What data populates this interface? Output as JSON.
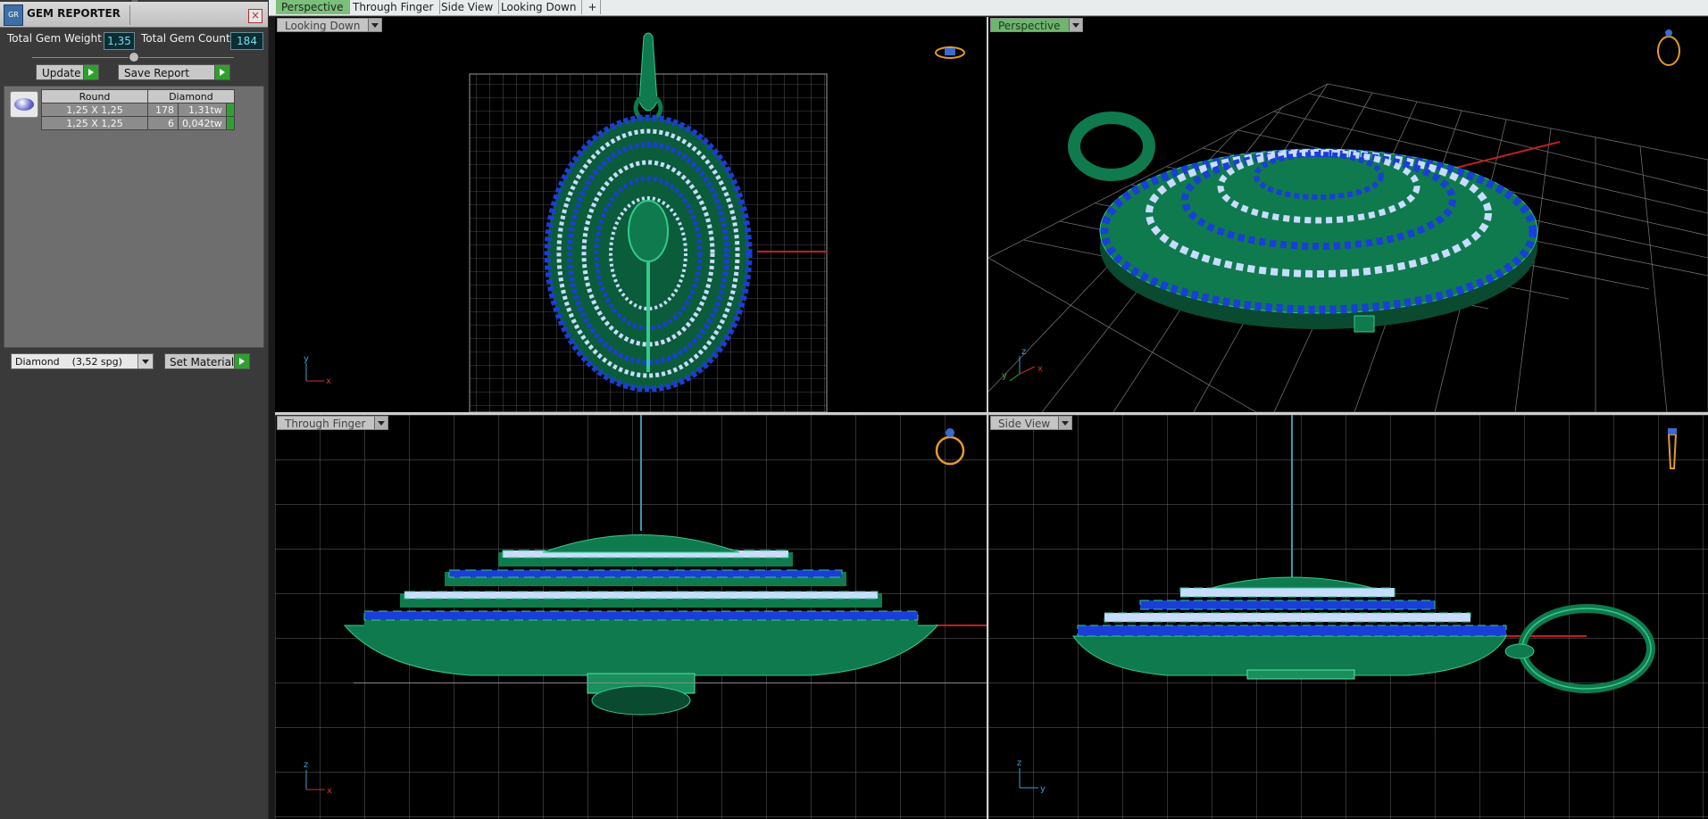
{
  "panel": {
    "title": "GEM REPORTER",
    "logo_text": "GR",
    "total_gem_weight_label": "Total Gem Weight",
    "total_gem_weight_value": "1,35",
    "total_gem_count_label": "Total Gem Count",
    "total_gem_count_value": "184",
    "update_label": "Update",
    "save_report_label": "Save Report",
    "table": {
      "headers": [
        "Round",
        "Diamond"
      ],
      "rows": [
        {
          "size": "1,25 X 1,25",
          "count": "178",
          "weight": "1,31tw"
        },
        {
          "size": "1,25 X 1,25",
          "count": "6",
          "weight": "0,042tw"
        }
      ]
    },
    "material_select_value": "Diamond    (3,52 spg)",
    "set_material_label": "Set Material"
  },
  "tabs": [
    "Perspective",
    "Through Finger",
    "Side View",
    "Looking Down"
  ],
  "tab_add_label": "+",
  "viewports": {
    "top_left": {
      "label": "Looking Down",
      "axis1": "y",
      "axis2": "x"
    },
    "top_right": {
      "label": "Perspective",
      "axis1": "z",
      "axis2": "y",
      "axis3": "x"
    },
    "bottom_left": {
      "label": "Through Finger",
      "axis1": "z",
      "axis2": "x"
    },
    "bottom_right": {
      "label": "Side View",
      "axis1": "z",
      "axis2": "y"
    }
  },
  "colors": {
    "metal": "#0f7a4e",
    "metal_light": "#35c98c",
    "stone_blue": "#1a3ed8",
    "stone_white": "#c9dcff",
    "grid": "#8a8a8a",
    "active_tab": "#7ac07a"
  }
}
